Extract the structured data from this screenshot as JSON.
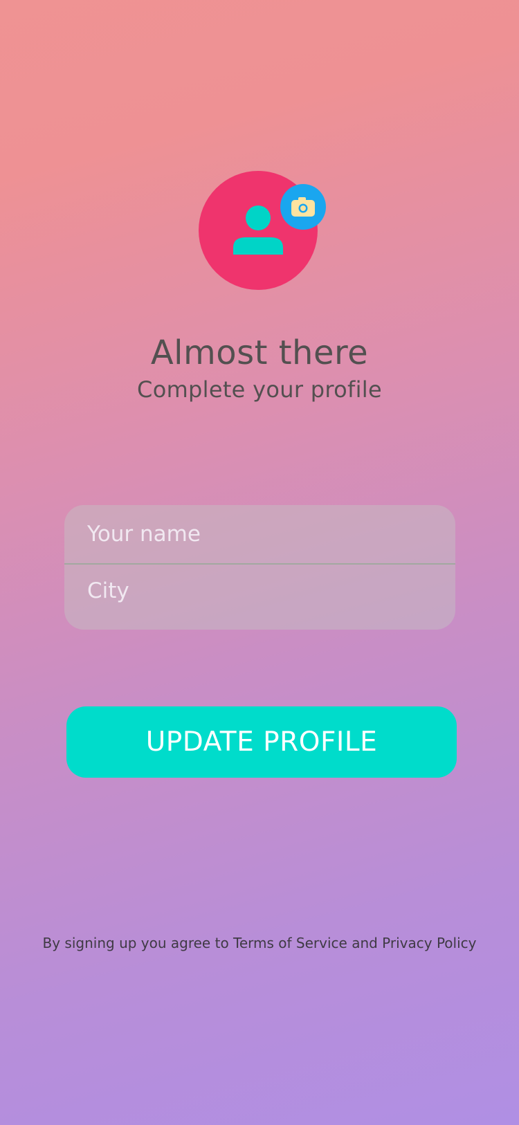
{
  "header": {
    "title": "Almost there",
    "subtitle": "Complete your profile"
  },
  "avatar": {
    "icon": "user-icon",
    "badge_icon": "camera-icon",
    "colors": {
      "avatar_bg": "#ef346d",
      "person": "#00d4c7",
      "badge_bg": "#1aa6ef",
      "camera": "#fde3a0"
    }
  },
  "form": {
    "name_placeholder": "Your name",
    "name_value": "",
    "city_placeholder": "City",
    "city_value": ""
  },
  "actions": {
    "update_label": "UPDATE PROFILE",
    "accent_color": "#00dccb"
  },
  "footer": {
    "terms_text": "By signing up you agree to Terms of Service and Privacy Policy"
  }
}
